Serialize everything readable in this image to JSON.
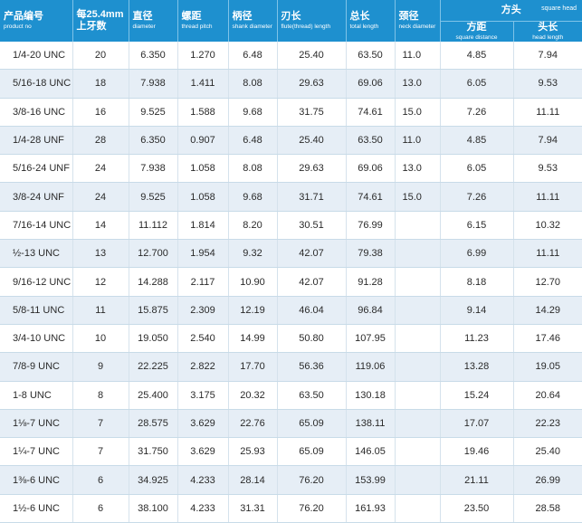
{
  "header": {
    "product_no": {
      "cn": "产品编号",
      "en": "product no"
    },
    "tpi": {
      "cn1": "每25.4mm",
      "cn2": "上牙数"
    },
    "diameter": {
      "cn": "直径",
      "en": "diameter"
    },
    "pitch": {
      "cn": "螺距",
      "en": "thread pitch"
    },
    "shank": {
      "cn": "柄径",
      "en": "shank diameter"
    },
    "flute": {
      "cn": "刃长",
      "en": "flute(thread) length"
    },
    "total": {
      "cn": "总长",
      "en": "total length"
    },
    "neck": {
      "cn": "颈径",
      "en": "neck diameter"
    },
    "square_head": {
      "cn": "方头",
      "en": "square head"
    },
    "square_distance": {
      "cn": "方距",
      "en": "square distance"
    },
    "head_length": {
      "cn": "头长",
      "en": "head length"
    }
  },
  "rows": [
    {
      "product": "1/4-20 UNC",
      "tpi": "20",
      "diameter": "6.350",
      "pitch": "1.270",
      "shank": "6.48",
      "flute": "25.40",
      "total": "63.50",
      "neck": "11.0",
      "square_distance": "4.85",
      "head_length": "7.94"
    },
    {
      "product": "5/16-18 UNC",
      "tpi": "18",
      "diameter": "7.938",
      "pitch": "1.411",
      "shank": "8.08",
      "flute": "29.63",
      "total": "69.06",
      "neck": "13.0",
      "square_distance": "6.05",
      "head_length": "9.53"
    },
    {
      "product": "3/8-16 UNC",
      "tpi": "16",
      "diameter": "9.525",
      "pitch": "1.588",
      "shank": "9.68",
      "flute": "31.75",
      "total": "74.61",
      "neck": "15.0",
      "square_distance": "7.26",
      "head_length": "11.11"
    },
    {
      "product": "1/4-28 UNF",
      "tpi": "28",
      "diameter": "6.350",
      "pitch": "0.907",
      "shank": "6.48",
      "flute": "25.40",
      "total": "63.50",
      "neck": "11.0",
      "square_distance": "4.85",
      "head_length": "7.94"
    },
    {
      "product": "5/16-24 UNF",
      "tpi": "24",
      "diameter": "7.938",
      "pitch": "1.058",
      "shank": "8.08",
      "flute": "29.63",
      "total": "69.06",
      "neck": "13.0",
      "square_distance": "6.05",
      "head_length": "9.53"
    },
    {
      "product": "3/8-24 UNF",
      "tpi": "24",
      "diameter": "9.525",
      "pitch": "1.058",
      "shank": "9.68",
      "flute": "31.71",
      "total": "74.61",
      "neck": "15.0",
      "square_distance": "7.26",
      "head_length": "11.11"
    },
    {
      "product": "7/16-14 UNC",
      "tpi": "14",
      "diameter": "11.112",
      "pitch": "1.814",
      "shank": "8.20",
      "flute": "30.51",
      "total": "76.99",
      "neck": "",
      "square_distance": "6.15",
      "head_length": "10.32"
    },
    {
      "product": "½-13 UNC",
      "tpi": "13",
      "diameter": "12.700",
      "pitch": "1.954",
      "shank": "9.32",
      "flute": "42.07",
      "total": "79.38",
      "neck": "",
      "square_distance": "6.99",
      "head_length": "11.11"
    },
    {
      "product": "9/16-12 UNC",
      "tpi": "12",
      "diameter": "14.288",
      "pitch": "2.117",
      "shank": "10.90",
      "flute": "42.07",
      "total": "91.28",
      "neck": "",
      "square_distance": "8.18",
      "head_length": "12.70"
    },
    {
      "product": "5/8-11 UNC",
      "tpi": "11",
      "diameter": "15.875",
      "pitch": "2.309",
      "shank": "12.19",
      "flute": "46.04",
      "total": "96.84",
      "neck": "",
      "square_distance": "9.14",
      "head_length": "14.29"
    },
    {
      "product": "3/4-10 UNC",
      "tpi": "10",
      "diameter": "19.050",
      "pitch": "2.540",
      "shank": "14.99",
      "flute": "50.80",
      "total": "107.95",
      "neck": "",
      "square_distance": "11.23",
      "head_length": "17.46"
    },
    {
      "product": "7/8-9 UNC",
      "tpi": "9",
      "diameter": "22.225",
      "pitch": "2.822",
      "shank": "17.70",
      "flute": "56.36",
      "total": "119.06",
      "neck": "",
      "square_distance": "13.28",
      "head_length": "19.05"
    },
    {
      "product": "1-8 UNC",
      "tpi": "8",
      "diameter": "25.400",
      "pitch": "3.175",
      "shank": "20.32",
      "flute": "63.50",
      "total": "130.18",
      "neck": "",
      "square_distance": "15.24",
      "head_length": "20.64"
    },
    {
      "product": "1⅛-7 UNC",
      "tpi": "7",
      "diameter": "28.575",
      "pitch": "3.629",
      "shank": "22.76",
      "flute": "65.09",
      "total": "138.11",
      "neck": "",
      "square_distance": "17.07",
      "head_length": "22.23"
    },
    {
      "product": "1¼-7 UNC",
      "tpi": "7",
      "diameter": "31.750",
      "pitch": "3.629",
      "shank": "25.93",
      "flute": "65.09",
      "total": "146.05",
      "neck": "",
      "square_distance": "19.46",
      "head_length": "25.40"
    },
    {
      "product": "1⅜-6 UNC",
      "tpi": "6",
      "diameter": "34.925",
      "pitch": "4.233",
      "shank": "28.14",
      "flute": "76.20",
      "total": "153.99",
      "neck": "",
      "square_distance": "21.11",
      "head_length": "26.99"
    },
    {
      "product": "1½-6 UNC",
      "tpi": "6",
      "diameter": "38.100",
      "pitch": "4.233",
      "shank": "31.31",
      "flute": "76.20",
      "total": "161.93",
      "neck": "",
      "square_distance": "23.50",
      "head_length": "28.58"
    }
  ]
}
